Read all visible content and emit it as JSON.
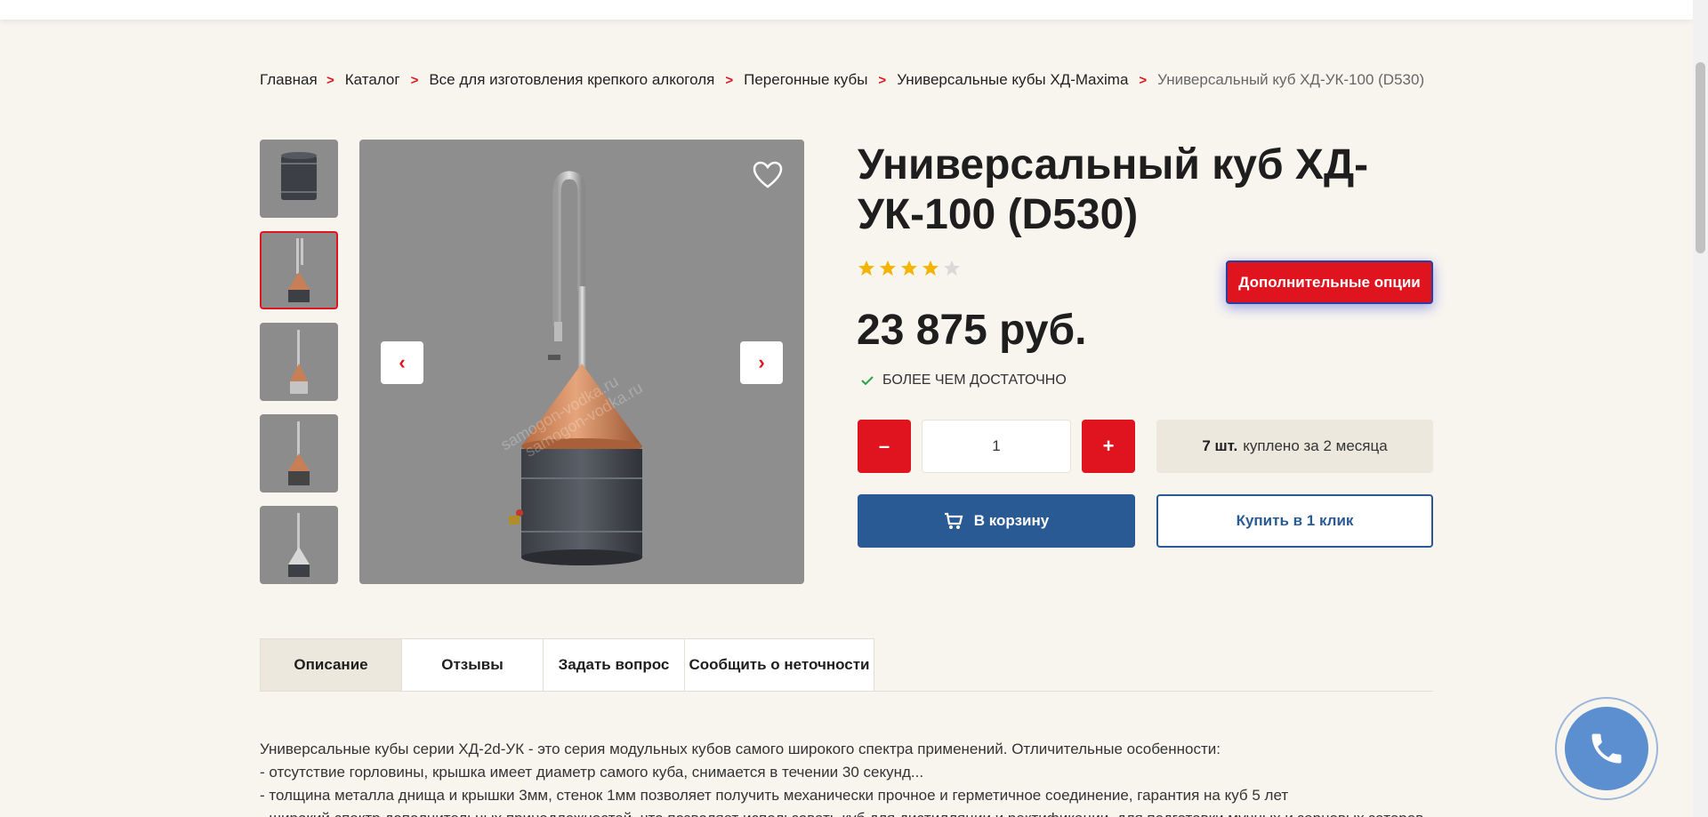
{
  "breadcrumb": {
    "items": [
      "Главная",
      "Каталог",
      "Все для изготовления крепкого алкоголя",
      "Перегонные кубы",
      "Универсальные кубы ХД-Maxima"
    ],
    "current": "Универсальный куб ХД-УК-100 (D530)",
    "separator": ">"
  },
  "product": {
    "title": "Универсальный куб ХД-УК-100 (D530)",
    "rating": 4,
    "rating_max": 5,
    "price": "23 875 руб.",
    "stock": "БОЛЕЕ ЧЕМ ДОСТАТОЧНО",
    "quantity": "1",
    "sold_count": "7 шт.",
    "sold_text": "куплено за 2 месяца",
    "options_label": "Дополнительные опции",
    "cart_label": "В корзину",
    "oneclick_label": "Купить в 1 клик",
    "minus_label": "–",
    "plus_label": "+"
  },
  "gallery": {
    "prev_icon": "‹",
    "next_icon": "›",
    "active_thumb": 1,
    "watermark_lines": [
      "samogon-vodka.ru",
      "samogon-vodka.ru"
    ]
  },
  "tabs": [
    "Описание",
    "Отзывы",
    "Задать вопрос",
    "Сообщить о неточности"
  ],
  "description": [
    "Универсальные кубы серии ХД-2d-УК - это серия модульных кубов самого широкого спектра применений. Отличительные особенности:",
    "- отсутствие горловины, крышка имеет диаметр самого куба, снимается в течении 30 секунд...",
    "- толщина металла днища и крышки 3мм, стенок 1мм позволяет получить механически прочное и герметичное соединение, гарантия на куб 5 лет",
    "- широкий спектр дополнительных принадлежностей, что позволяет использовать куб для дистилляции и ректификации, для подготовки мучных и зерновых заторов"
  ],
  "colors": {
    "accent_red": "#e0141e",
    "primary_blue": "#2a5a94",
    "star": "#f5b400",
    "background": "#f8f5ef"
  },
  "icons": {
    "favorite": "heart-icon",
    "cart": "cart-icon",
    "stock": "check-icon",
    "call": "phone-icon"
  }
}
